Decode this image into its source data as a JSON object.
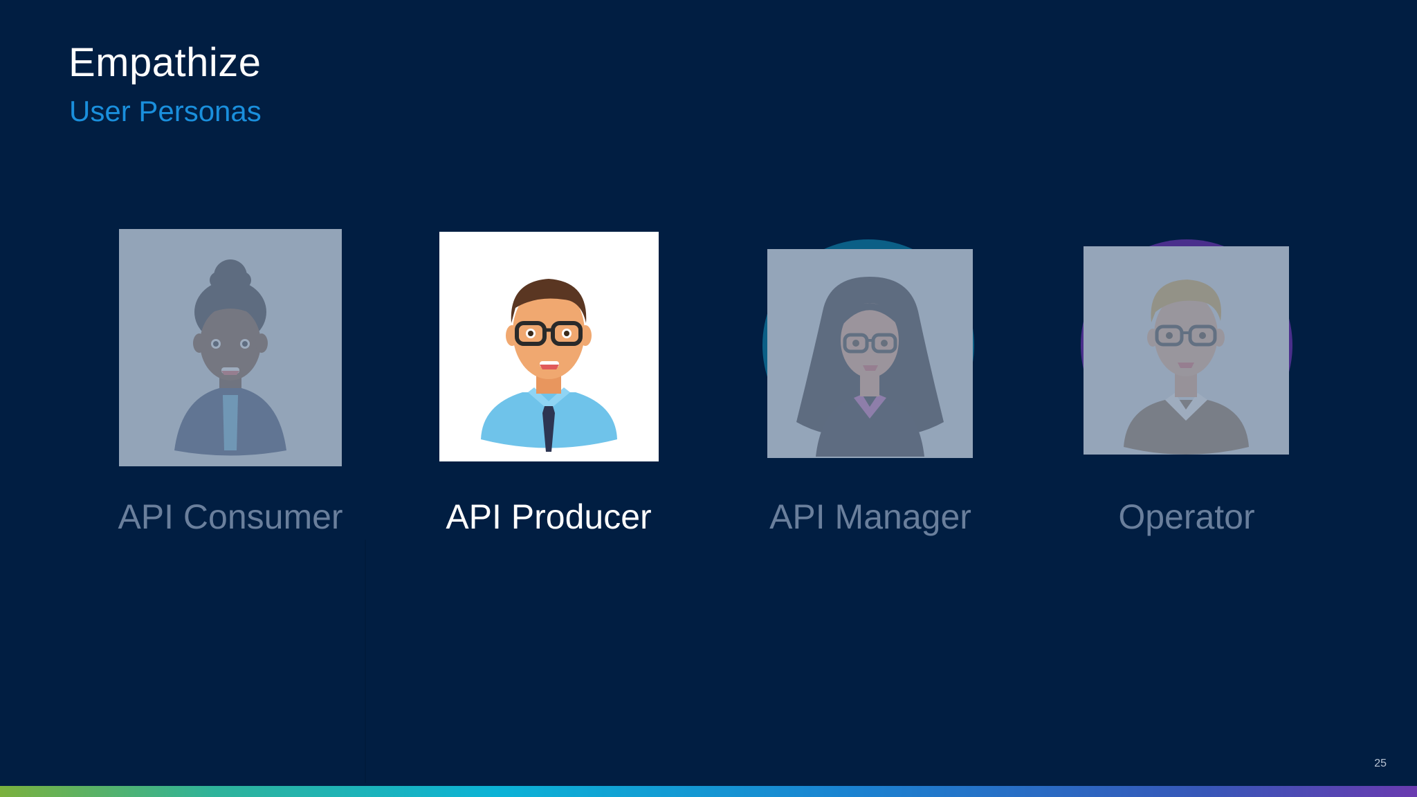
{
  "slide": {
    "title": "Empathize",
    "subtitle": "User Personas",
    "page_number": "25"
  },
  "personas": [
    {
      "label": "API Consumer",
      "state": "dimmed",
      "icon": "woman-avatar-icon"
    },
    {
      "label": "API Producer",
      "state": "active",
      "icon": "man-glasses-avatar-icon"
    },
    {
      "label": "API Manager",
      "state": "dimmed",
      "icon": "woman-long-hair-avatar-icon"
    },
    {
      "label": "Operator",
      "state": "dimmed",
      "icon": "blond-man-avatar-icon"
    }
  ],
  "colors": {
    "background": "#011e42",
    "title": "#ffffff",
    "subtitle": "#1a8fdc",
    "label_active": "#ffffff",
    "label_dimmed": "#6a7f9c"
  }
}
